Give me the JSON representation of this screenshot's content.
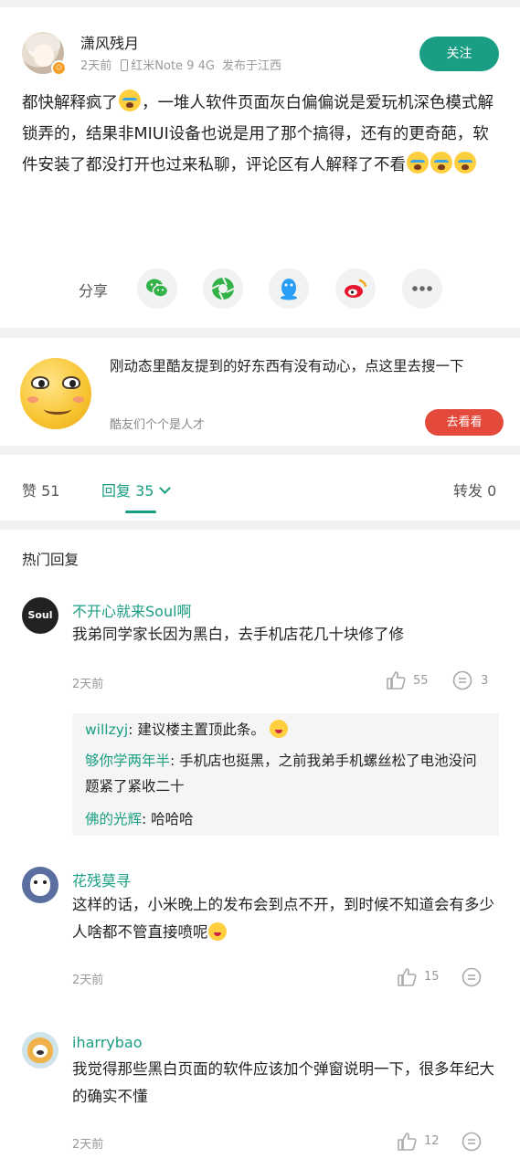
{
  "post": {
    "username": "潇风残月",
    "time": "2天前",
    "device": "红米Note 9 4G",
    "location": "发布于江西",
    "follow_label": "关注",
    "content_1": "都快解释疯了",
    "content_2": "，一堆人软件页面灰白偏偏说是爱玩机深色模式解锁弄的，结果非MIUI设备也说是用了那个搞得，还有的更奇葩，软件安装了都没打开也过来私聊，评论区有人解释了不看",
    "share_label": "分享",
    "share_icons": [
      "wechat-icon",
      "moments-icon",
      "qq-icon",
      "weibo-icon",
      "more-icon"
    ]
  },
  "promo": {
    "text": "刚动态里酷友提到的好东西有没有动心，点这里去搜一下",
    "subtext": "酷友们个个是人才",
    "button": "去看看"
  },
  "tabs": {
    "like_label": "赞",
    "like_count": "51",
    "reply_label": "回复",
    "reply_count": "35",
    "forward_label": "转发",
    "forward_count": "0"
  },
  "replies": {
    "section_title": "热门回复",
    "items": [
      {
        "name": "不开心就来Soul啊",
        "text": "我弟同学家长因为黑白，去手机店花几十块修了修",
        "time": "2天前",
        "likes": "55",
        "comments": "3",
        "avatar_text": "Soul",
        "subreplies": [
          {
            "name": "willzyj",
            "text": ": 建议楼主置顶此条。"
          },
          {
            "name": "够你学两年半",
            "text": ": 手机店也挺黑，之前我弟手机螺丝松了电池没问题紧了紧收二十"
          },
          {
            "name": "佛的光辉",
            "text": ": 哈哈哈"
          }
        ]
      },
      {
        "name": "花残莫寻",
        "text": "这样的话，小米晚上的发布会到点不开，到时候不知道会有多少人啥都不管直接喷呢",
        "time": "2天前",
        "likes": "15"
      },
      {
        "name": "iharrybao",
        "text": "我觉得那些黑白页面的软件应该加个弹窗说明一下，很多年纪大的确实不懂",
        "time": "2天前",
        "likes": "12"
      }
    ]
  },
  "colors": {
    "accent": "#1a9e83",
    "promo_button": "#e34a3b",
    "background": "#f1f1f1"
  }
}
